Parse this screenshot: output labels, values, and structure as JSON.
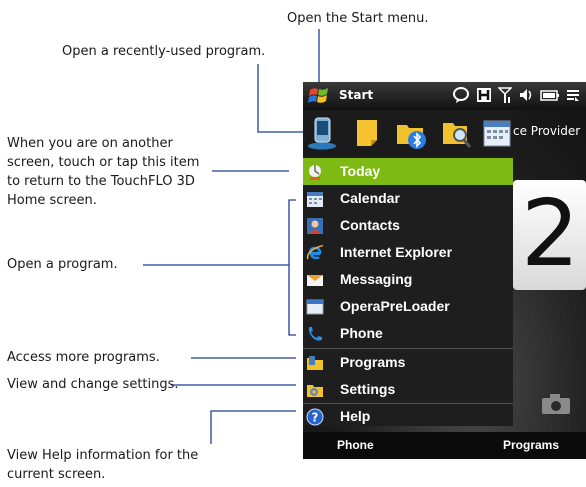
{
  "callouts": {
    "start_menu": "Open the Start menu.",
    "recent_program": "Open a recently-used program.",
    "today_line1": "When you are on another",
    "today_line2": "screen, touch or tap this item",
    "today_line3": "to return to the TouchFLO 3D",
    "today_line4": "Home screen.",
    "open_program": "Open a program.",
    "more_programs": "Access more programs.",
    "settings": "View and change settings.",
    "help_line1": "View Help information for the",
    "help_line2": "current screen."
  },
  "phone": {
    "start_label": "Start",
    "provider_text": "ce Provider",
    "clock_digit": "2",
    "menu_items": [
      {
        "label": "Today",
        "icon": "today-icon"
      },
      {
        "label": "Calendar",
        "icon": "calendar-icon"
      },
      {
        "label": "Contacts",
        "icon": "contacts-icon"
      },
      {
        "label": "Internet Explorer",
        "icon": "internet-explorer-icon"
      },
      {
        "label": "Messaging",
        "icon": "messaging-icon"
      },
      {
        "label": "OperaPreLoader",
        "icon": "operapreloader-icon"
      },
      {
        "label": "Phone",
        "icon": "phone-icon"
      },
      {
        "label": "Programs",
        "icon": "programs-folder-icon"
      },
      {
        "label": "Settings",
        "icon": "settings-icon"
      },
      {
        "label": "Help",
        "icon": "help-icon"
      }
    ],
    "recent_icons": [
      "phone-device-icon",
      "notes-icon",
      "bluetooth-folder-icon",
      "search-folder-icon",
      "calendar-icon"
    ],
    "softkeys": {
      "left": "Phone",
      "right": "Programs"
    }
  },
  "colors": {
    "selected_item": "#7dbb14",
    "menu_bg": "#1e1e1e",
    "callout_line": "#1f3f9a"
  }
}
